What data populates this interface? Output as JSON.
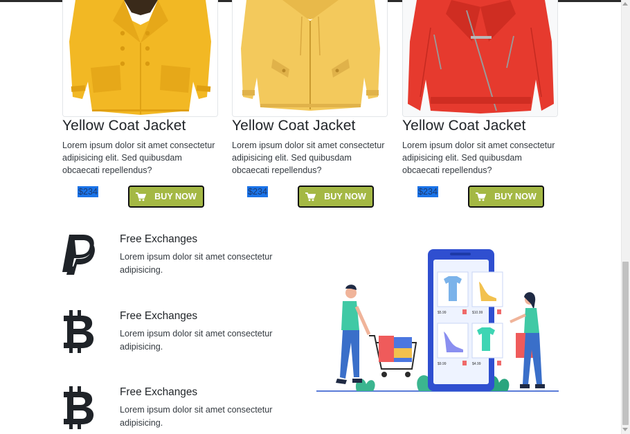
{
  "products": [
    {
      "title": "Yellow Coat Jacket",
      "description": "Lorem ipsum dolor sit amet consectetur adipisicing elit. Sed quibusdam obcaecati repellendus?",
      "price": "$234",
      "button_label": "BUY NOW",
      "image": "yellow-double-breasted-coat"
    },
    {
      "title": "Yellow Coat Jacket",
      "description": "Lorem ipsum dolor sit amet consectetur adipisicing elit. Sed quibusdam obcaecati repellendus?",
      "price": "$234",
      "button_label": "BUY NOW",
      "image": "light-yellow-jacket"
    },
    {
      "title": "Yellow Coat Jacket",
      "description": "Lorem ipsum dolor sit amet consectetur adipisicing elit. Sed quibusdam obcaecati repellendus?",
      "price": "$234",
      "button_label": "BUY NOW",
      "image": "red-leather-jacket"
    }
  ],
  "features": [
    {
      "icon": "paypal-icon",
      "title": "Free Exchanges",
      "text": "Lorem ipsum dolor sit amet consectetur adipisicing."
    },
    {
      "icon": "bitcoin-icon",
      "title": "Free Exchanges",
      "text": "Lorem ipsum dolor sit amet consectetur adipisicing."
    },
    {
      "icon": "bitcoin-icon",
      "title": "Free Exchanges",
      "text": "Lorem ipsum dolor sit amet consectetur adipisicing."
    }
  ],
  "illustration": {
    "prices": [
      "$5.99",
      "$10.99",
      "$9.99",
      "$4.99"
    ]
  },
  "colors": {
    "button": "#a4b844",
    "price_highlight": "#1a73e8",
    "jacket_yellow": "#f2b824",
    "jacket_light_yellow": "#f3c95c",
    "jacket_red": "#e63a2e"
  }
}
